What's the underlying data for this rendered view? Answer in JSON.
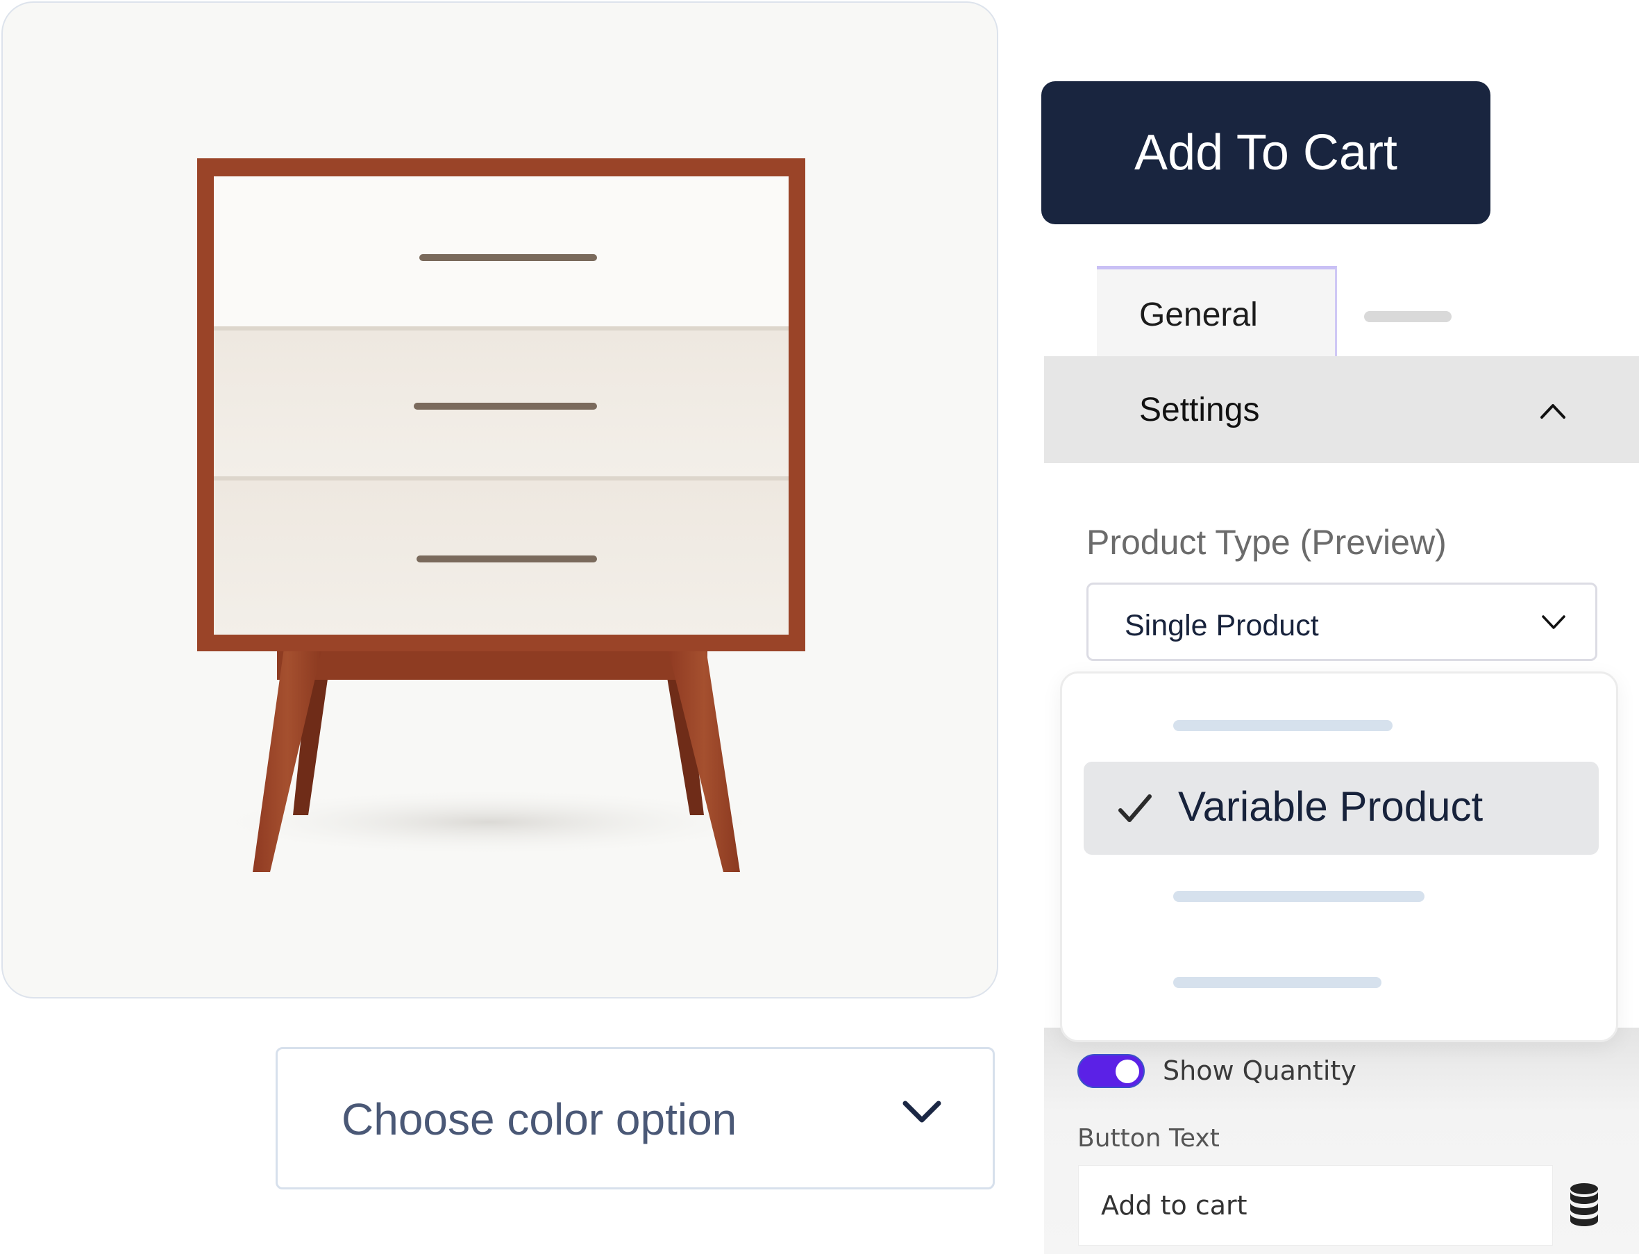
{
  "product": {
    "image_alt": "Mid-century three-drawer dresser",
    "color_select": {
      "placeholder": "Choose color option",
      "icon": "chevron-down-icon"
    }
  },
  "actions": {
    "add_to_cart_label": "Add To Cart"
  },
  "tabs": [
    {
      "label": "General",
      "active": true
    },
    {
      "label": "",
      "placeholder": true
    }
  ],
  "settings": {
    "title": "Settings",
    "expanded": true,
    "product_type": {
      "label": "Product Type (Preview)",
      "selected": "Single Product",
      "options": [
        {
          "label": "",
          "placeholder": true
        },
        {
          "label": "Variable Product",
          "checked": true,
          "highlighted": true
        },
        {
          "label": "",
          "placeholder": true
        },
        {
          "label": "",
          "placeholder": true
        }
      ]
    },
    "show_quantity": {
      "label": "Show Quantity",
      "enabled": true
    },
    "button_text": {
      "label": "Button Text",
      "value": "Add to cart",
      "icon": "database-icon"
    }
  },
  "colors": {
    "primary": "#19253f",
    "toggle_on": "#5b21e6",
    "tab_accent": "#c9c0f5",
    "settings_bg": "#e6e6e6",
    "placeholder_line": "#d6e1ed",
    "dresser_wood": "#a0482a",
    "dresser_panel": "#efe9e2"
  }
}
